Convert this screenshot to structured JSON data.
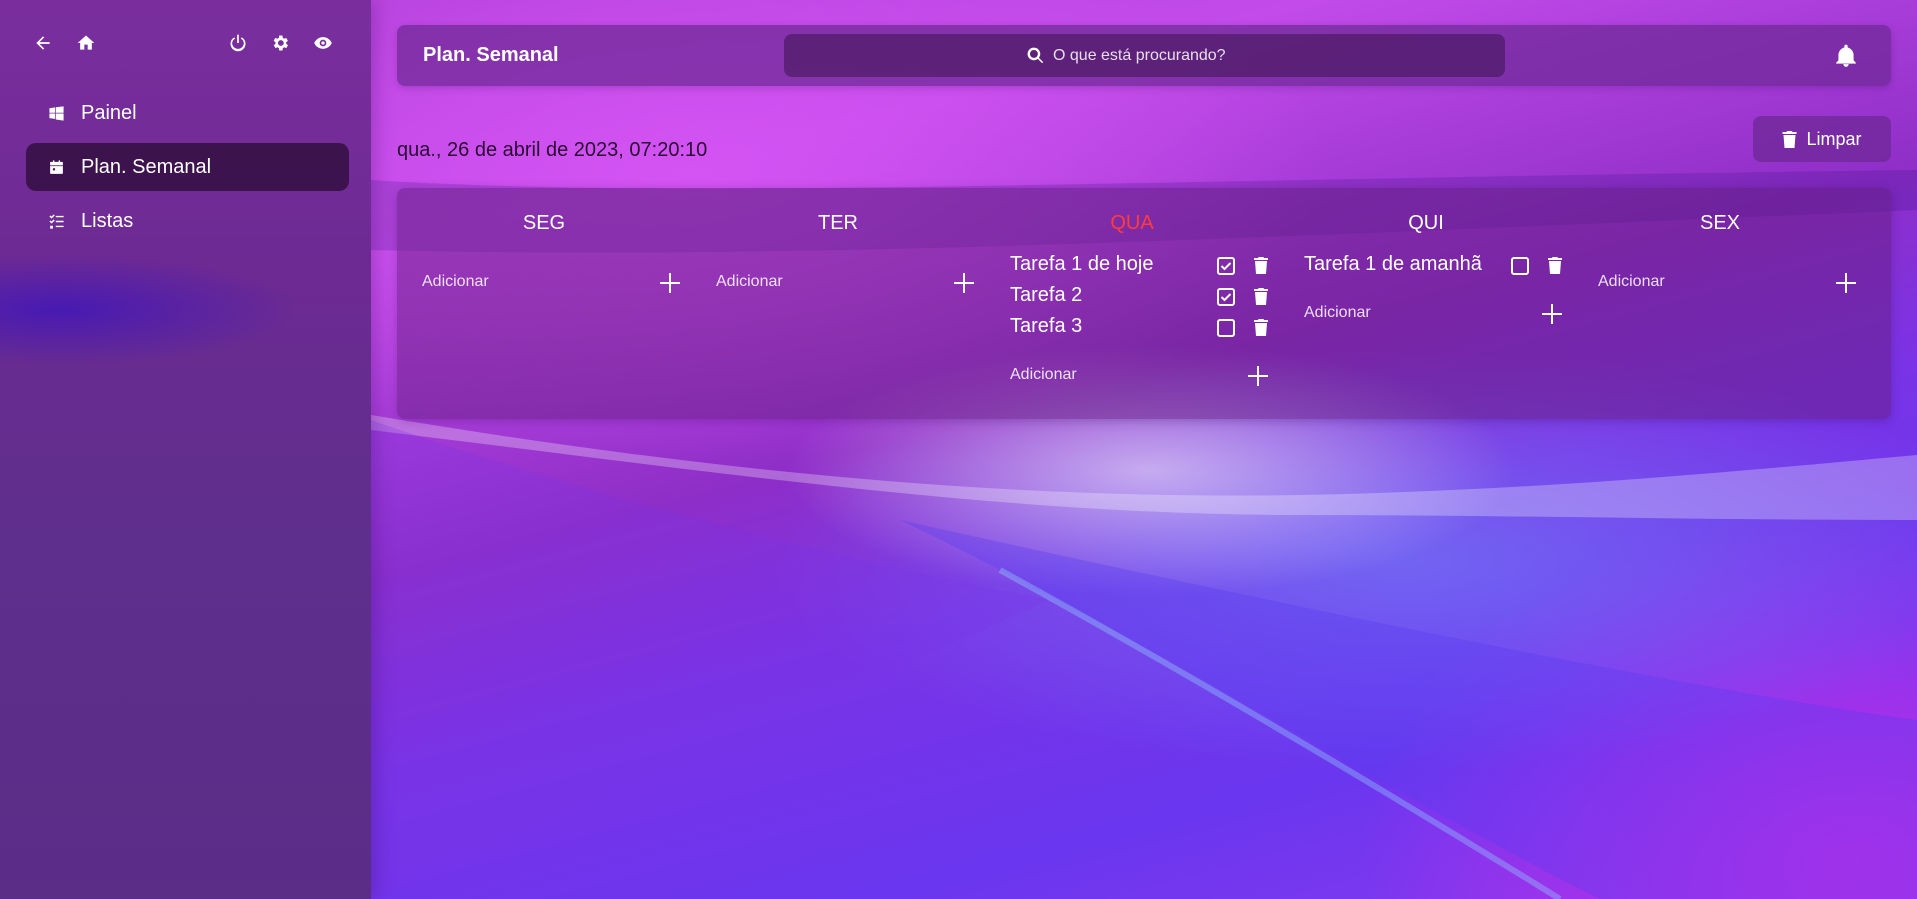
{
  "sidebar": {
    "top_icons": [
      "arrow-left-icon",
      "home-icon",
      "power-icon",
      "gear-icon",
      "eye-icon"
    ],
    "items": [
      {
        "label": "Painel",
        "icon": "windows-icon",
        "active": false
      },
      {
        "label": "Plan. Semanal",
        "icon": "calendar-icon",
        "active": true
      },
      {
        "label": "Listas",
        "icon": "checklist-icon",
        "active": false
      }
    ]
  },
  "header": {
    "title": "Plan. Semanal",
    "search_placeholder": "O que está procurando?",
    "notification_icon": "bell-icon"
  },
  "datetime": "qua., 26 de abril de 2023, 07:20:10",
  "clear_button": {
    "label": "Limpar",
    "icon": "trash-icon"
  },
  "board": {
    "add_placeholder": "Adicionar",
    "today_color": "#ff3b3b",
    "days": [
      {
        "label": "SEG",
        "today": false,
        "tasks": []
      },
      {
        "label": "TER",
        "today": false,
        "tasks": []
      },
      {
        "label": "QUA",
        "today": true,
        "tasks": [
          {
            "name": "Tarefa 1 de hoje",
            "done": true
          },
          {
            "name": "Tarefa 2",
            "done": true
          },
          {
            "name": "Tarefa 3",
            "done": false
          }
        ]
      },
      {
        "label": "QUI",
        "today": false,
        "tasks": [
          {
            "name": "Tarefa 1 de amanhã",
            "done": false
          }
        ]
      },
      {
        "label": "SEX",
        "today": false,
        "tasks": []
      }
    ]
  }
}
